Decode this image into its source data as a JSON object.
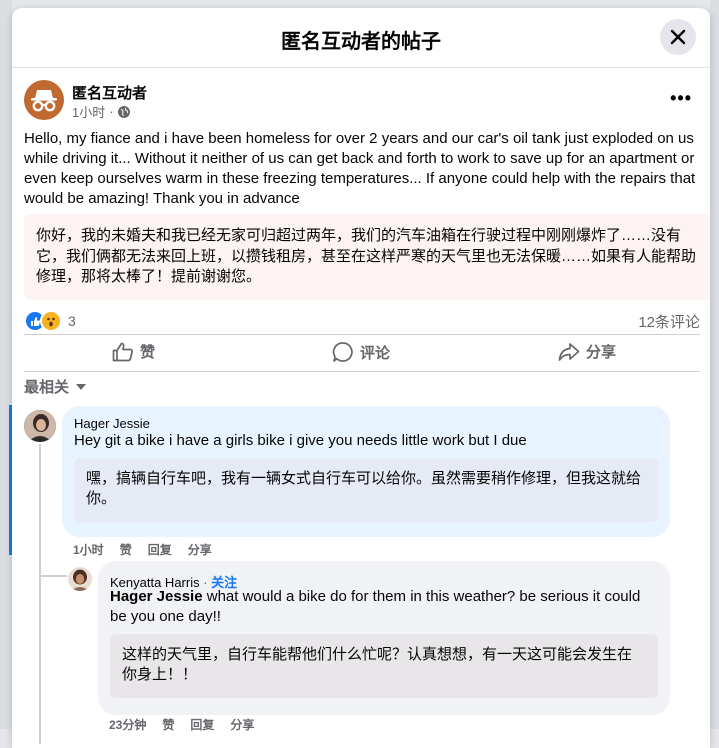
{
  "modal": {
    "title": "匿名互动者的帖子"
  },
  "post": {
    "author": "匿名互动者",
    "time": "1小时",
    "text": "Hello, my fiance and i have been homeless for over 2 years and our car's oil tank just exploded on us while driving it... Without it neither of us can get back and forth to work to save up for an apartment or even keep ourselves warm in these freezing temperatures... If anyone could help with the repairs that would be amazing! Thank you in advance",
    "translation": "你好，我的未婚夫和我已经无家可归超过两年，我们的汽车油箱在行驶过程中刚刚爆炸了……没有它，我们俩都无法来回上班，以攒钱租房，甚至在这样严寒的天气里也无法保暖……如果有人能帮助修理，那将太棒了！提前谢谢您。",
    "reaction_count": "3",
    "comment_count": "12条评论"
  },
  "actions": {
    "like": "赞",
    "comment": "评论",
    "share": "分享"
  },
  "sort": {
    "label": "最相关"
  },
  "comments": [
    {
      "author": "Hager Jessie",
      "text": "Hey git a bike i have a girls bike i give you needs little work but I due",
      "translation": "嘿，搞辆自行车吧，我有一辆女式自行车可以给你。虽然需要稍作修理，但我这就给你。",
      "time": "1小时",
      "like": "赞",
      "reply": "回复",
      "share": "分享"
    },
    {
      "author": "Kenyatta Harris",
      "separator": " · ",
      "follow": "关注",
      "mention": "Hager Jessie",
      "text": " what would a bike do for them in this weather? be serious it could be you one day!!",
      "translation": "这样的天气里，自行车能帮他们什么忙呢？认真想想，有一天这可能会发生在你身上！！",
      "time": "23分钟",
      "like": "赞",
      "reply": "回复",
      "share": "分享"
    }
  ],
  "colors": {
    "accent": "#1877f2",
    "translation_bg": "#fdf3f3",
    "bubble_blue": "#e7f3ff",
    "bubble_gray": "#f0f2f5"
  },
  "icons": [
    "close-icon",
    "incognito-icon",
    "globe-icon",
    "more-icon",
    "like-reaction-icon",
    "wow-reaction-icon",
    "thumbs-up-icon",
    "comment-bubble-icon",
    "share-arrow-icon",
    "caret-down-icon"
  ]
}
